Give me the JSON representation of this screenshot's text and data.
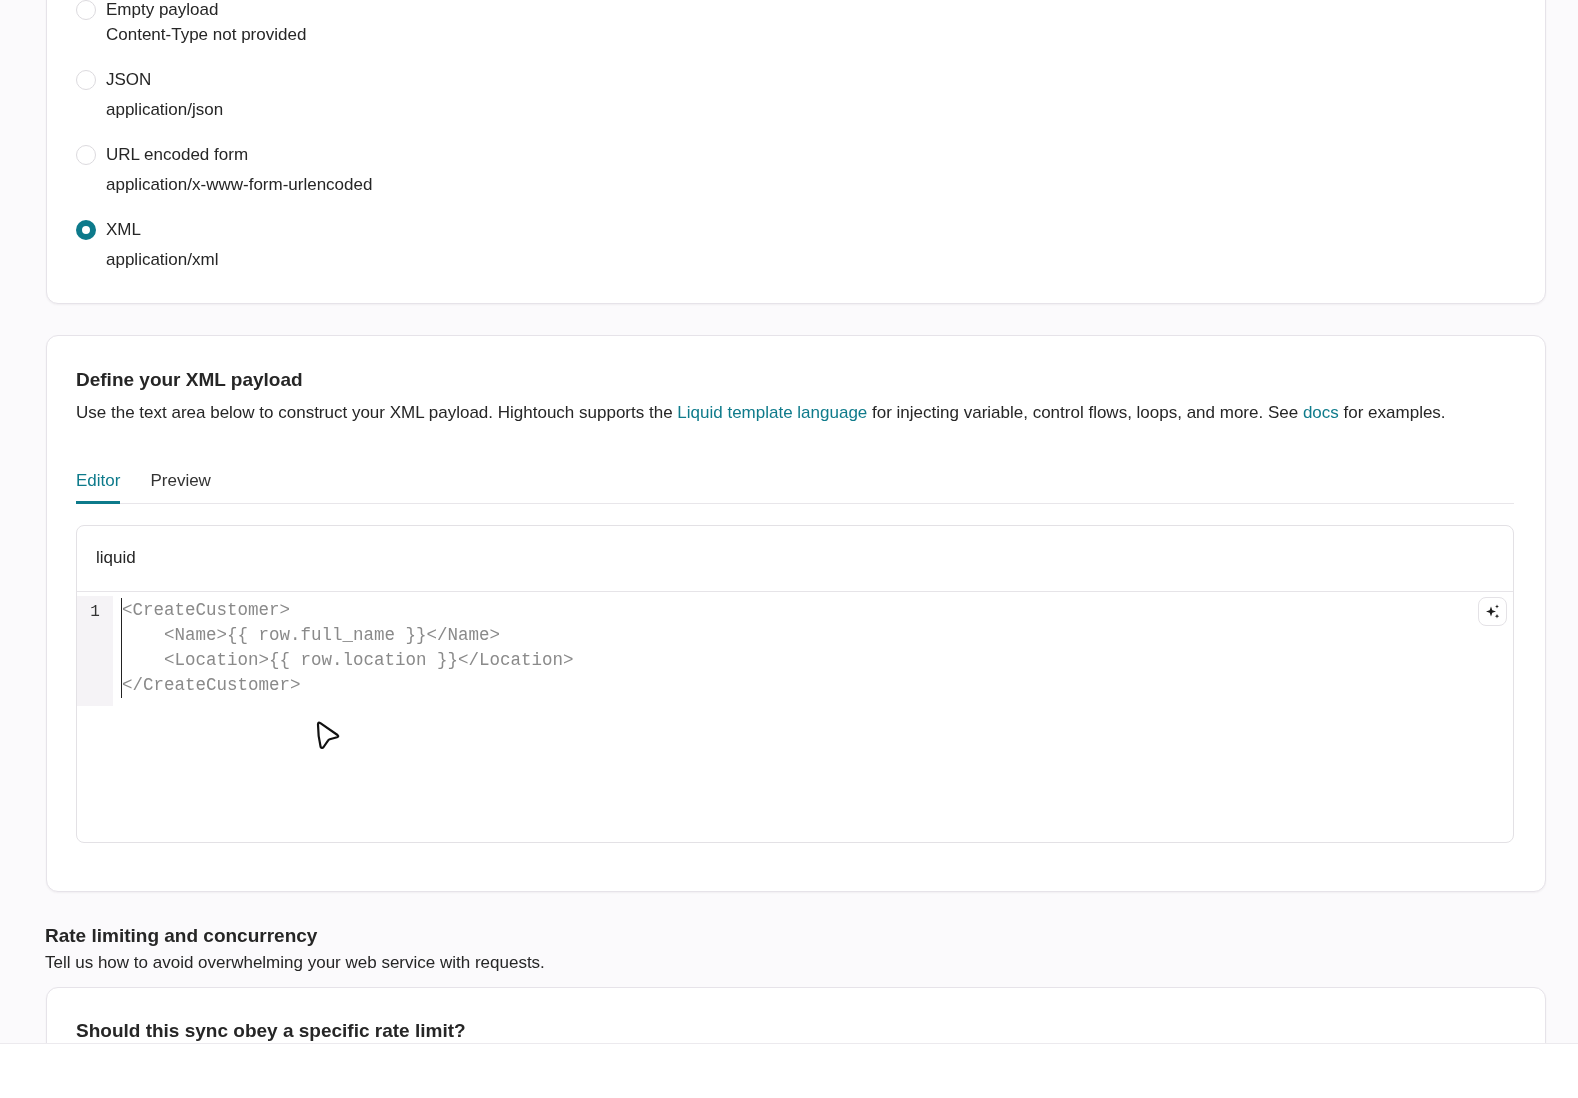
{
  "content_type_options": [
    {
      "label": "Empty payload",
      "description": "Content-Type not provided",
      "selected": false
    },
    {
      "label": "JSON",
      "description": "application/json",
      "selected": false
    },
    {
      "label": "URL encoded form",
      "description": "application/x-www-form-urlencoded",
      "selected": false
    },
    {
      "label": "XML",
      "description": "application/xml",
      "selected": true
    }
  ],
  "payload": {
    "title": "Define your XML payload",
    "description": [
      {
        "kind": "text",
        "text": "Use the text area below to construct your XML payload. Hightouch supports the "
      },
      {
        "kind": "link",
        "text": "Liquid template language"
      },
      {
        "kind": "text",
        "text": " for injecting variable, control flows, loops, and more. See "
      },
      {
        "kind": "link",
        "text": "docs"
      },
      {
        "kind": "text",
        "text": " for examples."
      }
    ],
    "tabs": [
      {
        "label": "Editor",
        "selected": true
      },
      {
        "label": "Preview",
        "selected": false
      }
    ],
    "editor": {
      "language": "liquid",
      "line_numbers": [
        "1"
      ],
      "code": [
        "<CreateCustomer>",
        "    <Name>{{ row.full_name }}</Name>",
        "    <Location>{{ row.location }}</Location>",
        "</CreateCustomer>"
      ]
    }
  },
  "rate_limiting": {
    "title": "Rate limiting and concurrency",
    "description": "Tell us how to avoid overwhelming your web service with requests.",
    "question": "Should this sync obey a specific rate limit?"
  }
}
